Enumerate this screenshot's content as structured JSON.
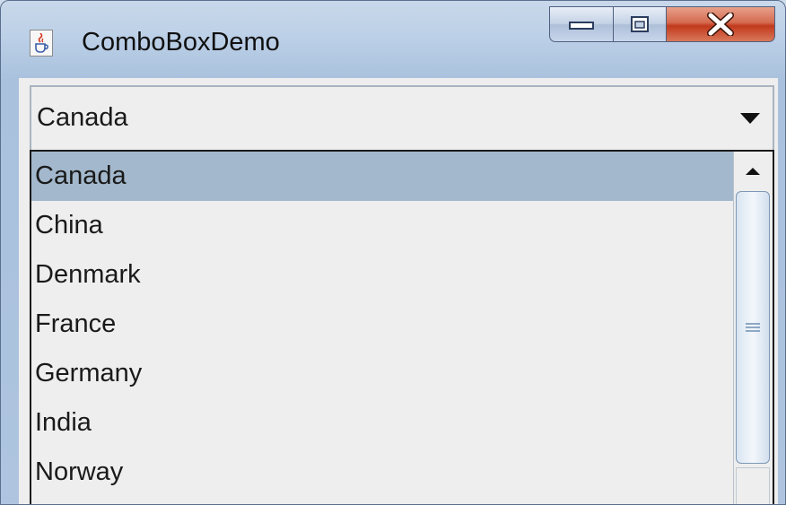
{
  "window": {
    "title": "ComboBoxDemo",
    "icon": "java-cup-icon",
    "controls": {
      "minimize_icon": "minimize-icon",
      "maximize_icon": "maximize-icon",
      "close_icon": "close-icon",
      "close_color": "#c2391c"
    }
  },
  "combo": {
    "selected": "Canada",
    "arrow_icon": "chevron-down-icon"
  },
  "dropdown": {
    "items": [
      {
        "label": "Canada",
        "selected": true
      },
      {
        "label": "China",
        "selected": false
      },
      {
        "label": "Denmark",
        "selected": false
      },
      {
        "label": "France",
        "selected": false
      },
      {
        "label": "Germany",
        "selected": false
      },
      {
        "label": "India",
        "selected": false
      },
      {
        "label": "Norway",
        "selected": false
      }
    ],
    "selection_color": "#a3b8cc"
  },
  "scrollbar": {
    "up_icon": "scroll-up-arrow-icon",
    "thumb_grip_icon": "grip-icon"
  }
}
